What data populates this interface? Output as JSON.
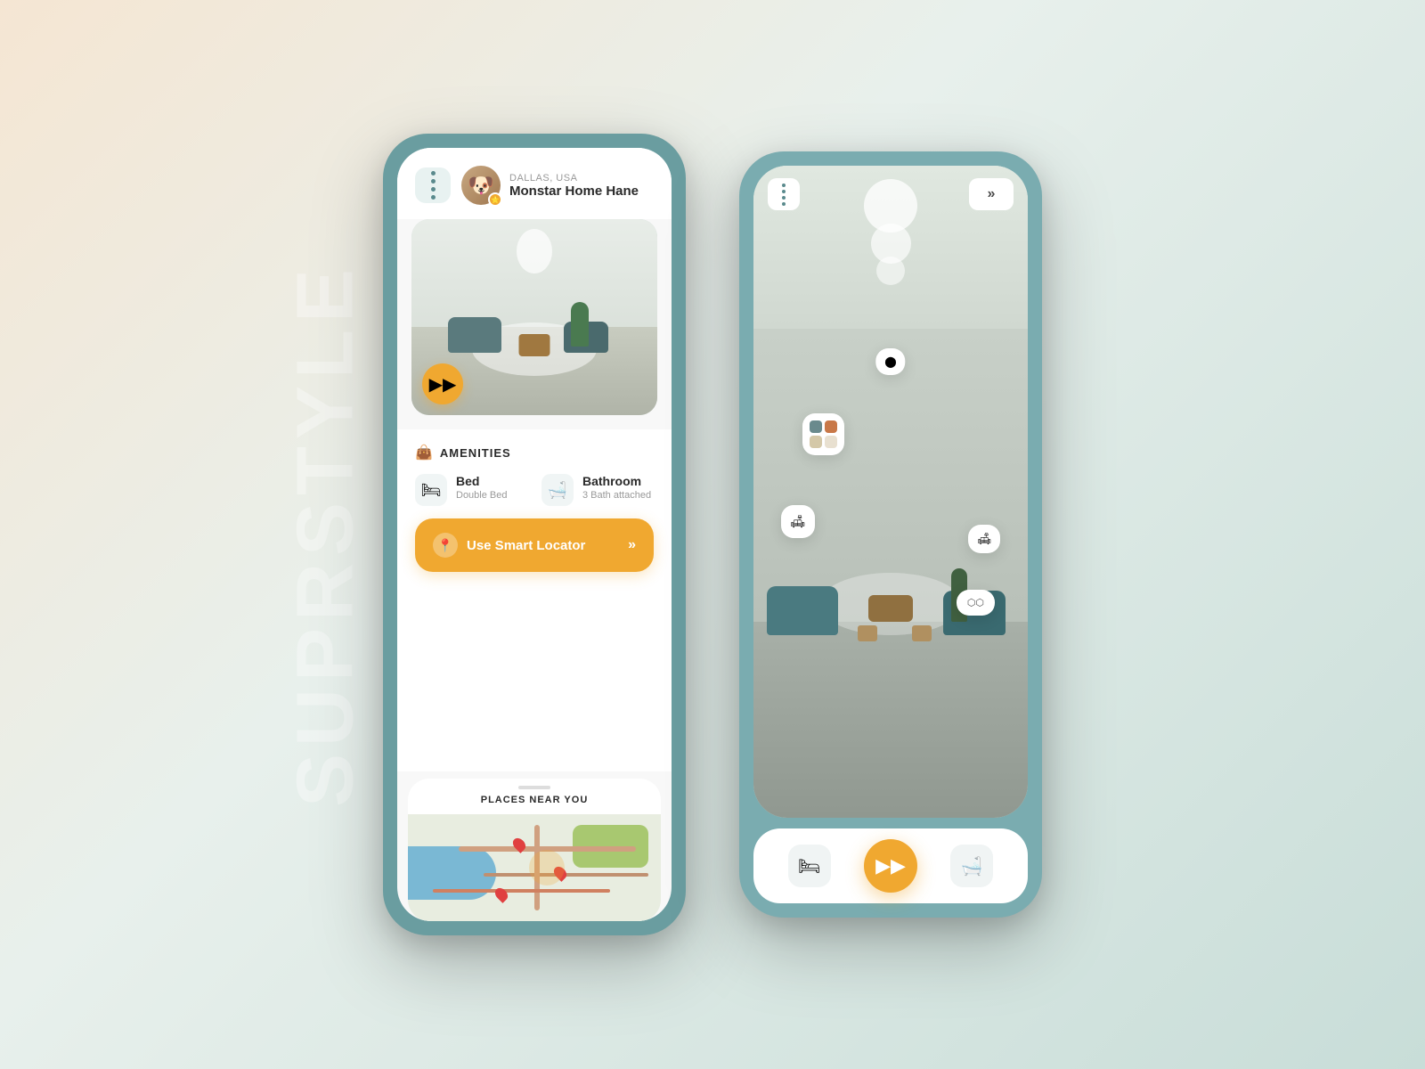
{
  "watermark": {
    "text": "SUPRSTYLE"
  },
  "left_phone": {
    "menu_label": "⋮⋮",
    "user": {
      "location": "DALLAS, USA",
      "name": "Monstar Home Hane"
    },
    "vr_button_label": "▶▶",
    "amenities": {
      "title": "AMENITIES",
      "icon": "👜",
      "items": [
        {
          "name": "Bed",
          "desc": "Double Bed",
          "icon": "🛏"
        },
        {
          "name": "Bathroom",
          "desc": "3 Bath attached",
          "icon": "🛁"
        }
      ]
    },
    "smart_locator": {
      "label": "Use Smart Locator",
      "arrow": "»"
    },
    "map": {
      "title": "PLACES NEAR YOU"
    }
  },
  "right_phone": {
    "menu_label": "⋮⋮",
    "next_label": "»",
    "tabs": [
      {
        "icon": "🛏",
        "active": false
      },
      {
        "icon": "▶▶",
        "active": true
      },
      {
        "icon": "🛁",
        "active": false
      }
    ],
    "ar_tags": {
      "color_swatches": [
        "#6a8a8d",
        "#c87848",
        "#d4c8a8"
      ],
      "sofa_label": "🛋",
      "lamp_label": "💡"
    }
  },
  "colors": {
    "orange": "#f0a830",
    "teal": "#6a9da0",
    "white": "#ffffff",
    "text_dark": "#2a2a2a",
    "text_muted": "#999999"
  }
}
